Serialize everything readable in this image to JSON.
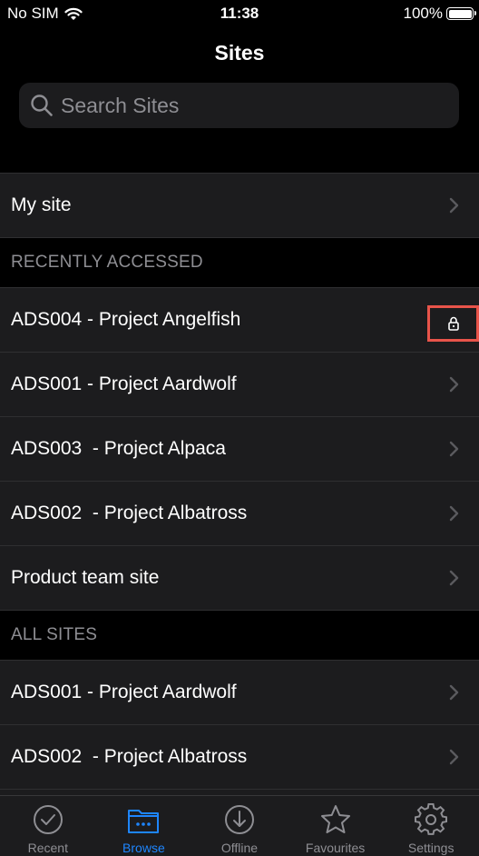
{
  "status_bar": {
    "carrier": "No SIM",
    "time": "11:38",
    "battery": "100%"
  },
  "nav": {
    "title": "Sites"
  },
  "search": {
    "placeholder": "Search Sites"
  },
  "my_site": {
    "label": "My site"
  },
  "sections": {
    "recent_header": "RECENTLY ACCESSED",
    "recent": [
      {
        "label": "ADS004 - Project Angelfish",
        "locked": true
      },
      {
        "label": "ADS001 - Project Aardwolf"
      },
      {
        "label": "ADS003  - Project Alpaca"
      },
      {
        "label": "ADS002  - Project Albatross"
      },
      {
        "label": "Product team site"
      }
    ],
    "all_header": "ALL SITES",
    "all": [
      {
        "label": "ADS001 - Project Aardwolf"
      },
      {
        "label": "ADS002  - Project Albatross"
      }
    ]
  },
  "tab_bar": {
    "tabs": [
      {
        "label": "Recent",
        "icon": "check-circle-icon"
      },
      {
        "label": "Browse",
        "icon": "folder-icon",
        "active": true
      },
      {
        "label": "Offline",
        "icon": "download-icon"
      },
      {
        "label": "Favourites",
        "icon": "star-icon"
      },
      {
        "label": "Settings",
        "icon": "gear-icon"
      }
    ]
  },
  "colors": {
    "accent": "#1e86ff",
    "highlight": "#e8544a",
    "row_bg": "#1c1c1e"
  }
}
